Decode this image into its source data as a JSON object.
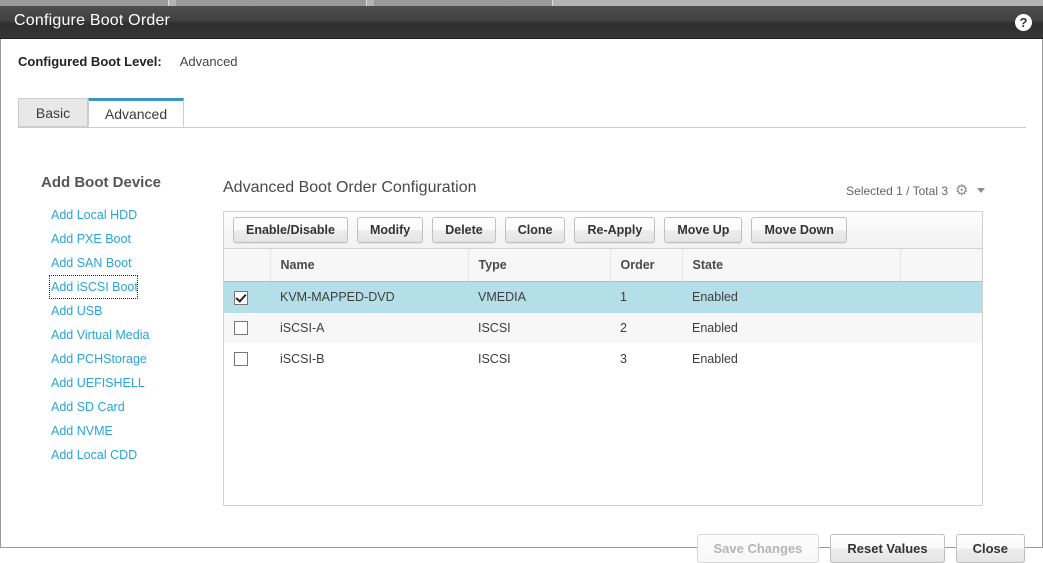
{
  "window": {
    "title": "Configure Boot Order",
    "help_icon": "question-mark-icon"
  },
  "boot_level": {
    "label": "Configured Boot Level:",
    "value": "Advanced"
  },
  "tabs": [
    {
      "label": "Basic",
      "active": false
    },
    {
      "label": "Advanced",
      "active": true
    }
  ],
  "sidebar": {
    "heading": "Add Boot Device",
    "items": [
      {
        "label": "Add Local HDD",
        "focused": false
      },
      {
        "label": "Add PXE Boot",
        "focused": false
      },
      {
        "label": "Add SAN Boot",
        "focused": false
      },
      {
        "label": "Add iSCSI Boot",
        "focused": true
      },
      {
        "label": "Add USB",
        "focused": false
      },
      {
        "label": "Add Virtual Media",
        "focused": false
      },
      {
        "label": "Add PCHStorage",
        "focused": false
      },
      {
        "label": "Add UEFISHELL",
        "focused": false
      },
      {
        "label": "Add SD Card",
        "focused": false
      },
      {
        "label": "Add NVME",
        "focused": false
      },
      {
        "label": "Add Local CDD",
        "focused": false
      }
    ]
  },
  "main": {
    "heading": "Advanced Boot Order Configuration",
    "count_text": "Selected 1 / Total 3",
    "gear_icon": "gear-icon",
    "caret_icon": "chevron-down-icon"
  },
  "toolbar": {
    "buttons": [
      {
        "label": "Enable/Disable",
        "disabled": false
      },
      {
        "label": "Modify",
        "disabled": false
      },
      {
        "label": "Delete",
        "disabled": false
      },
      {
        "label": "Clone",
        "disabled": false
      },
      {
        "label": "Re-Apply",
        "disabled": false
      },
      {
        "label": "Move Up",
        "disabled": false
      },
      {
        "label": "Move Down",
        "disabled": false
      }
    ]
  },
  "table": {
    "columns": [
      "",
      "Name",
      "Type",
      "Order",
      "State",
      ""
    ],
    "rows": [
      {
        "checked": true,
        "selected": true,
        "name": "KVM-MAPPED-DVD",
        "type": "VMEDIA",
        "order": "1",
        "state": "Enabled"
      },
      {
        "checked": false,
        "selected": false,
        "name": "iSCSI-A",
        "type": "ISCSI",
        "order": "2",
        "state": "Enabled"
      },
      {
        "checked": false,
        "selected": false,
        "name": "iSCSI-B",
        "type": "ISCSI",
        "order": "3",
        "state": "Enabled"
      }
    ]
  },
  "footer": {
    "buttons": [
      {
        "label": "Save Changes",
        "disabled": true
      },
      {
        "label": "Reset Values",
        "disabled": false
      },
      {
        "label": "Close",
        "disabled": false
      }
    ]
  },
  "colors": {
    "accent": "#3a96bd",
    "link": "#2aa5d6",
    "selected_row": "#b5dfe8",
    "titlebar": "#3a3a3a"
  }
}
